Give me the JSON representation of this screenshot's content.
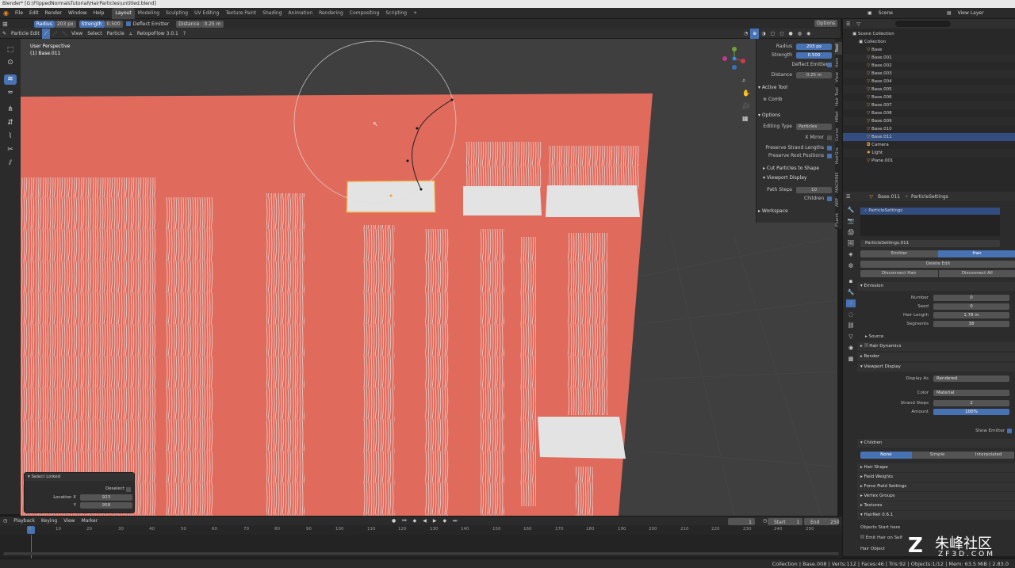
{
  "titlebar": {
    "text": "Blender* [G:\\FlippedNormalsTutorial\\HairParticles\\untitled.blend]"
  },
  "menu": {
    "items": [
      "File",
      "Edit",
      "Render",
      "Window",
      "Help"
    ]
  },
  "workspaces": [
    "Layout",
    "Modeling",
    "Sculpting",
    "UV Editing",
    "Texture Paint",
    "Shading",
    "Animation",
    "Rendering",
    "Compositing",
    "Scripting"
  ],
  "active_workspace": "Layout",
  "scene": {
    "label": "Scene",
    "view_layer": "View Layer"
  },
  "tool_header": {
    "radius_label": "Radius",
    "radius_value": "203 px",
    "strength_label": "Strength",
    "strength_value": "0.500",
    "deflect": "Deflect Emitter",
    "distance_label": "Distance",
    "distance_value": "0.25 m",
    "options": "Options"
  },
  "mode_header": {
    "mode": "Particle Edit",
    "view": "View",
    "select": "Select",
    "particle": "Particle",
    "addon": "RetopoFlow 3.0.1"
  },
  "viewport": {
    "perspective": "User Perspective",
    "object": "(1) Base.011"
  },
  "npanel": {
    "radius_label": "Radius",
    "radius_value": "203 px",
    "strength_label": "Strength",
    "strength_value": "0.500",
    "deflect": "Deflect Emitter",
    "distance_label": "Distance",
    "distance_value": "0.25 m",
    "active_tool": "Active Tool",
    "tool_name": "Comb",
    "options": "Options",
    "editing_type_label": "Editing Type",
    "editing_type_value": "Particles",
    "x_mirror": "X Mirror",
    "preserve_lengths": "Preserve Strand Lengths",
    "preserve_roots": "Preserve Root Positions",
    "cut_particles": "Cut Particles to Shape",
    "viewport_display": "Viewport Display",
    "path_steps_label": "Path Steps",
    "path_steps_value": "10",
    "children": "Children",
    "workspace": "Workspace"
  },
  "ntabs": [
    "Tool",
    "Item",
    "View",
    "Hair Tool",
    "HNet",
    "Curve",
    "HairGrs",
    "MACHIN3",
    "ARP",
    "Fluent"
  ],
  "outliner": {
    "scene_collection": "Scene Collection",
    "collection": "Collection",
    "items": [
      "Base",
      "Base.001",
      "Base.002",
      "Base.003",
      "Base.004",
      "Base.005",
      "Base.006",
      "Base.007",
      "Base.008",
      "Base.009",
      "Base.010",
      "Base.011",
      "Camera",
      "Light",
      "Plane.001"
    ],
    "selected": "Base.011"
  },
  "properties": {
    "object": "Base.011",
    "settings": "ParticleSettings",
    "slot": "ParticleSettings",
    "datablock": "ParticleSettings.011",
    "emitter": "Emitter",
    "hair": "Hair",
    "delete_edit": "Delete Edit",
    "disconnect_hair": "Disconnect Hair",
    "disconnect_all": "Disconnect All",
    "emission": "Emission",
    "number_label": "Number",
    "number_value": "0",
    "seed_label": "Seed",
    "seed_value": "0",
    "hair_length_label": "Hair Length",
    "hair_length_value": "1.78 m",
    "segments_label": "Segments",
    "segments_value": "38",
    "source": "Source",
    "hair_dynamics": "Hair Dynamics",
    "render": "Render",
    "viewport_display": "Viewport Display",
    "display_as_label": "Display As",
    "display_as_value": "Rendered",
    "color_label": "Color",
    "color_value": "Material",
    "strand_steps_label": "Strand Steps",
    "strand_steps_value": "2",
    "amount_label": "Amount",
    "amount_value": "100%",
    "show_emitter": "Show Emitter",
    "children": "Children",
    "none": "None",
    "simple": "Simple",
    "interpolated": "Interpolated",
    "hair_shape": "Hair Shape",
    "field_weights": "Field Weights",
    "force_field": "Force Field Settings",
    "vertex_groups": "Vertex Groups",
    "textures": "Textures",
    "hairnet": "HairNet 0.6.1",
    "objects_start": "Objects Start here",
    "emit_hair": "Emit Hair on Self",
    "hair_object": "Hair Object"
  },
  "select_linked": {
    "title": "Select Linked",
    "deselect": "Deselect",
    "loc_x_label": "Location X",
    "loc_x_value": "923",
    "y_label": "Y",
    "y_value": "958"
  },
  "timeline": {
    "playback": "Playback",
    "keying": "Keying",
    "view": "View",
    "marker": "Marker",
    "current": "1",
    "start_label": "Start",
    "start_value": "1",
    "end_label": "End",
    "end_value": "250",
    "ticks": [
      "0",
      "10",
      "20",
      "30",
      "40",
      "50",
      "60",
      "70",
      "80",
      "90",
      "100",
      "110",
      "120",
      "130",
      "140",
      "150",
      "160",
      "170",
      "180",
      "190",
      "200",
      "210",
      "220",
      "230",
      "240",
      "250"
    ]
  },
  "statusbar": {
    "text": "Collection | Base.008 | Verts:112 | Faces:46 | Tris:92 | Objects:1/12 | Mem: 63.5 MiB | 2.83.0"
  },
  "watermark": {
    "text": "朱峰社区",
    "sub": "ZF3D.COM"
  },
  "colors": {
    "accent": "#4772b3",
    "plane": "#e06b5c",
    "selected_outline": "#f0a030"
  }
}
